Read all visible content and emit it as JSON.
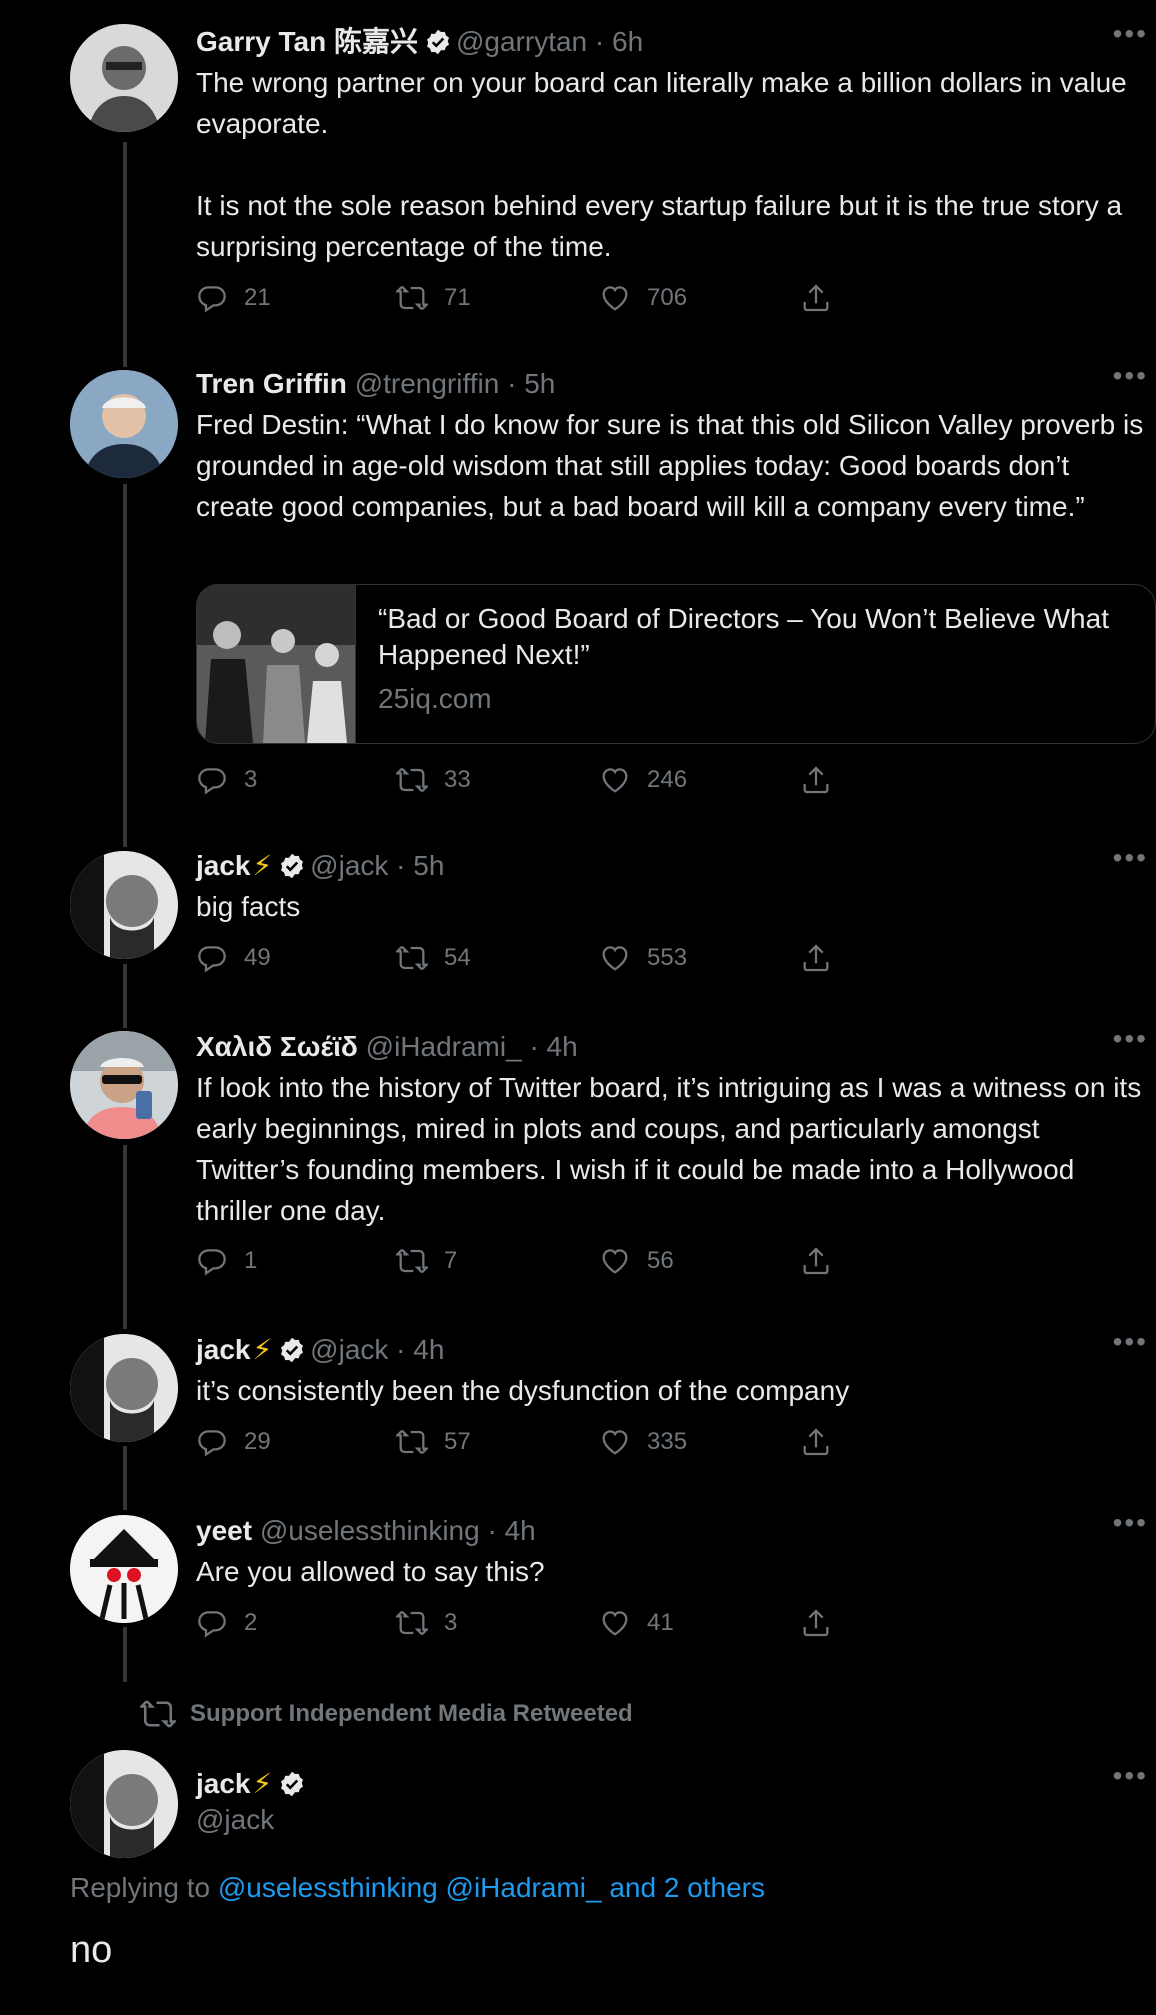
{
  "colors": {
    "background": "#000000",
    "text": "#e7e9ea",
    "muted": "#71767b",
    "link": "#1d9bf0",
    "verified": "#e7e9ea",
    "bolt": "#f5c518"
  },
  "tweets": [
    {
      "name": "Garry Tan 陈嘉兴",
      "verified": true,
      "handle": "@garrytan · 6h",
      "text1": "The wrong partner on your board can literally make a billion dollars in value evaporate.",
      "text2": "It is not the sole reason behind every startup failure but it is the true story a surprising percentage of the time.",
      "replies": "21",
      "retweets": "71",
      "likes": "706"
    },
    {
      "name": "Tren Griffin",
      "verified": false,
      "handle": "@trengriffin · 5h",
      "text1": "Fred Destin: “What I do know for sure is that this old Silicon Valley proverb is grounded in age-old wisdom that still applies today: Good boards don’t create good companies, but a bad board will kill a company every time.”",
      "card_title": "“Bad or Good Board of Directors – You Won’t Believe What Happened Next!”",
      "card_domain": "25iq.com",
      "replies": "3",
      "retweets": "33",
      "likes": "246"
    },
    {
      "name": "jack",
      "bolt": "⚡",
      "verified": true,
      "handle": "@jack · 5h",
      "text1": "big facts",
      "replies": "49",
      "retweets": "54",
      "likes": "553"
    },
    {
      "name": "Χαλιδ Σωέϊδ",
      "verified": false,
      "handle": "@iHadrami_ · 4h",
      "text1": "If look into the history of Twitter board, it’s intriguing as I was a witness on its early beginnings, mired in plots and coups, and particularly amongst Twitter’s founding members. I wish if it could be made into a Hollywood thriller one day.",
      "replies": "1",
      "retweets": "7",
      "likes": "56"
    },
    {
      "name": "jack",
      "bolt": "⚡",
      "verified": true,
      "handle": "@jack · 4h",
      "text1": "it’s consistently been the dysfunction of the company",
      "replies": "29",
      "retweets": "57",
      "likes": "335"
    },
    {
      "name": "yeet",
      "verified": false,
      "handle": "@uselessthinking · 4h",
      "text1": "Are you allowed to say this?",
      "replies": "2",
      "retweets": "3",
      "likes": "41"
    }
  ],
  "retweet_banner": "Support Independent Media Retweeted",
  "main_tweet": {
    "name": "jack",
    "bolt": "⚡",
    "handle": "@jack",
    "replying_prefix": "Replying to",
    "replying_to": "@uselessthinking @iHadrami_ and 2 others",
    "text": "no"
  },
  "more_glyph": "•••",
  "icons": [
    "reply-icon",
    "retweet-icon",
    "like-icon",
    "share-icon",
    "verified-icon",
    "more-icon"
  ]
}
